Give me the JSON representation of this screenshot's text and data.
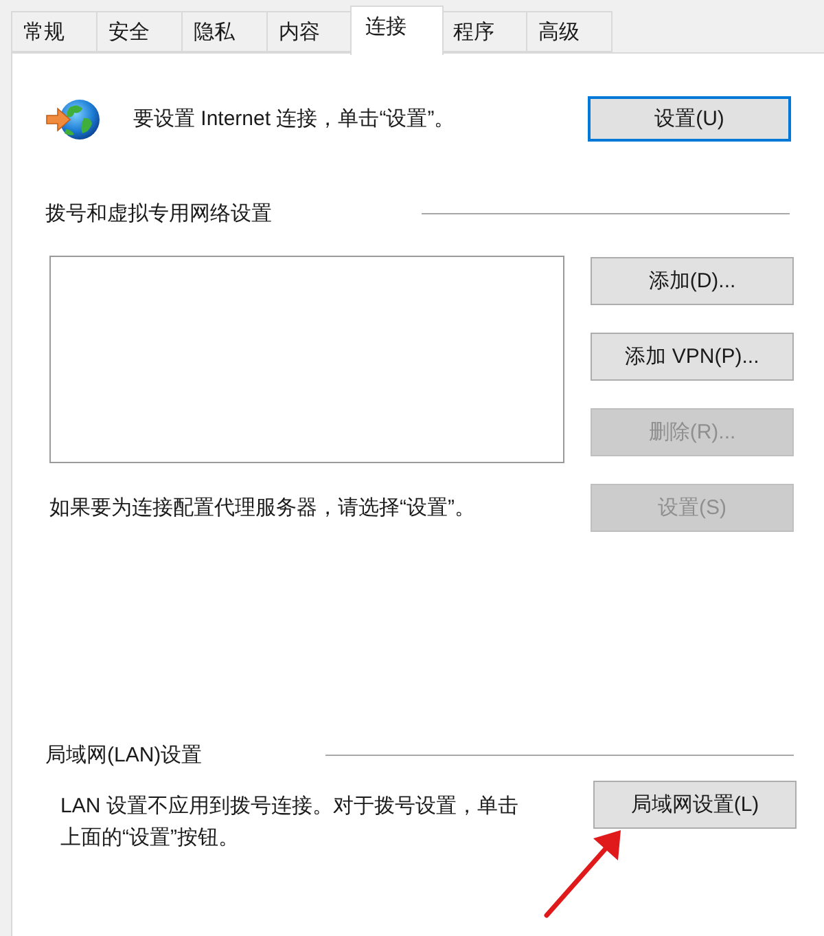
{
  "tabs": [
    {
      "label": "常规",
      "selected": false
    },
    {
      "label": "安全",
      "selected": false
    },
    {
      "label": "隐私",
      "selected": false
    },
    {
      "label": "内容",
      "selected": false
    },
    {
      "label": "连接",
      "selected": true
    },
    {
      "label": "程序",
      "selected": false
    },
    {
      "label": "高级",
      "selected": false
    }
  ],
  "setup": {
    "text": "要设置 Internet 连接，单击“设置”。",
    "button": {
      "label": "设置(U)",
      "default": true,
      "disabled": false
    }
  },
  "dialup": {
    "heading": "拨号和虚拟专用网络设置",
    "buttons": [
      {
        "label": "添加(D)...",
        "disabled": false
      },
      {
        "label": "添加 VPN(P)...",
        "disabled": false
      },
      {
        "label": "删除(R)...",
        "disabled": true
      }
    ],
    "proxy_text": "如果要为连接配置代理服务器，请选择“设置”。",
    "settings_button": {
      "label": "设置(S)",
      "disabled": true
    }
  },
  "lan": {
    "heading": "局域网(LAN)设置",
    "text": "LAN 设置不应用到拨号连接。对于拨号设置，单击上面的“设置”按钮。",
    "button": {
      "label": "局域网设置(L)",
      "disabled": false
    }
  }
}
